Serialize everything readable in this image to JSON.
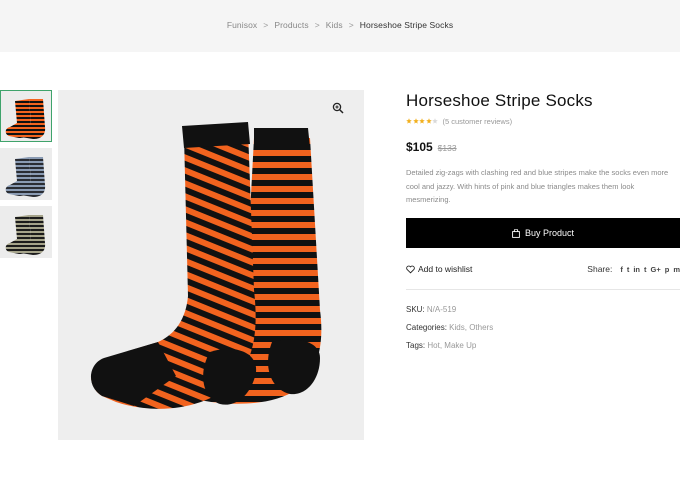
{
  "breadcrumb": {
    "items": [
      "Funisox",
      "Products",
      "Kids"
    ],
    "separator": ">",
    "current": "Horseshoe Stripe Socks"
  },
  "product": {
    "title": "Horseshoe Stripe Socks",
    "rating": 4,
    "reviews_text": "(5 customer reviews)",
    "price": "$105",
    "old_price": "$133",
    "description": "Detailed zig-zags with clashing red and blue stripes make the socks even more cool and jazzy. With hints of pink and blue triangles makes them look mesmerizing.",
    "buy_label": "Buy Product",
    "wishlist_label": "Add to wishlist",
    "share_label": "Share:",
    "share_icons": [
      "f",
      "t",
      "in",
      "t",
      "G+",
      "p",
      "m"
    ],
    "share_icon_names": [
      "facebook-icon",
      "twitter-icon",
      "linkedin-icon",
      "tumblr-icon",
      "google-plus-icon",
      "pinterest-icon",
      "email-icon"
    ],
    "sku_label": "SKU:",
    "sku": "N/A-519",
    "categories_label": "Categories:",
    "categories": [
      "Kids",
      "Others"
    ],
    "tags_label": "Tags:",
    "tags": [
      "Hot",
      "Make Up"
    ]
  },
  "gallery": {
    "thumbnails": [
      {
        "name": "orange-black-stripe-socks",
        "stripe_a": "#f2631e",
        "stripe_b": "#111111",
        "active": true
      },
      {
        "name": "blue-grey-stripe-socks",
        "stripe_a": "#8a9bb3",
        "stripe_b": "#2a2d33",
        "active": false
      },
      {
        "name": "olive-black-stripe-socks",
        "stripe_a": "#a5a38a",
        "stripe_b": "#1b1b1b",
        "active": false
      }
    ]
  },
  "colors": {
    "accent": "#000000",
    "stripe_orange": "#f2631e",
    "stripe_black": "#111111",
    "star": "#f2b01e",
    "active_border": "#3fa36b"
  }
}
